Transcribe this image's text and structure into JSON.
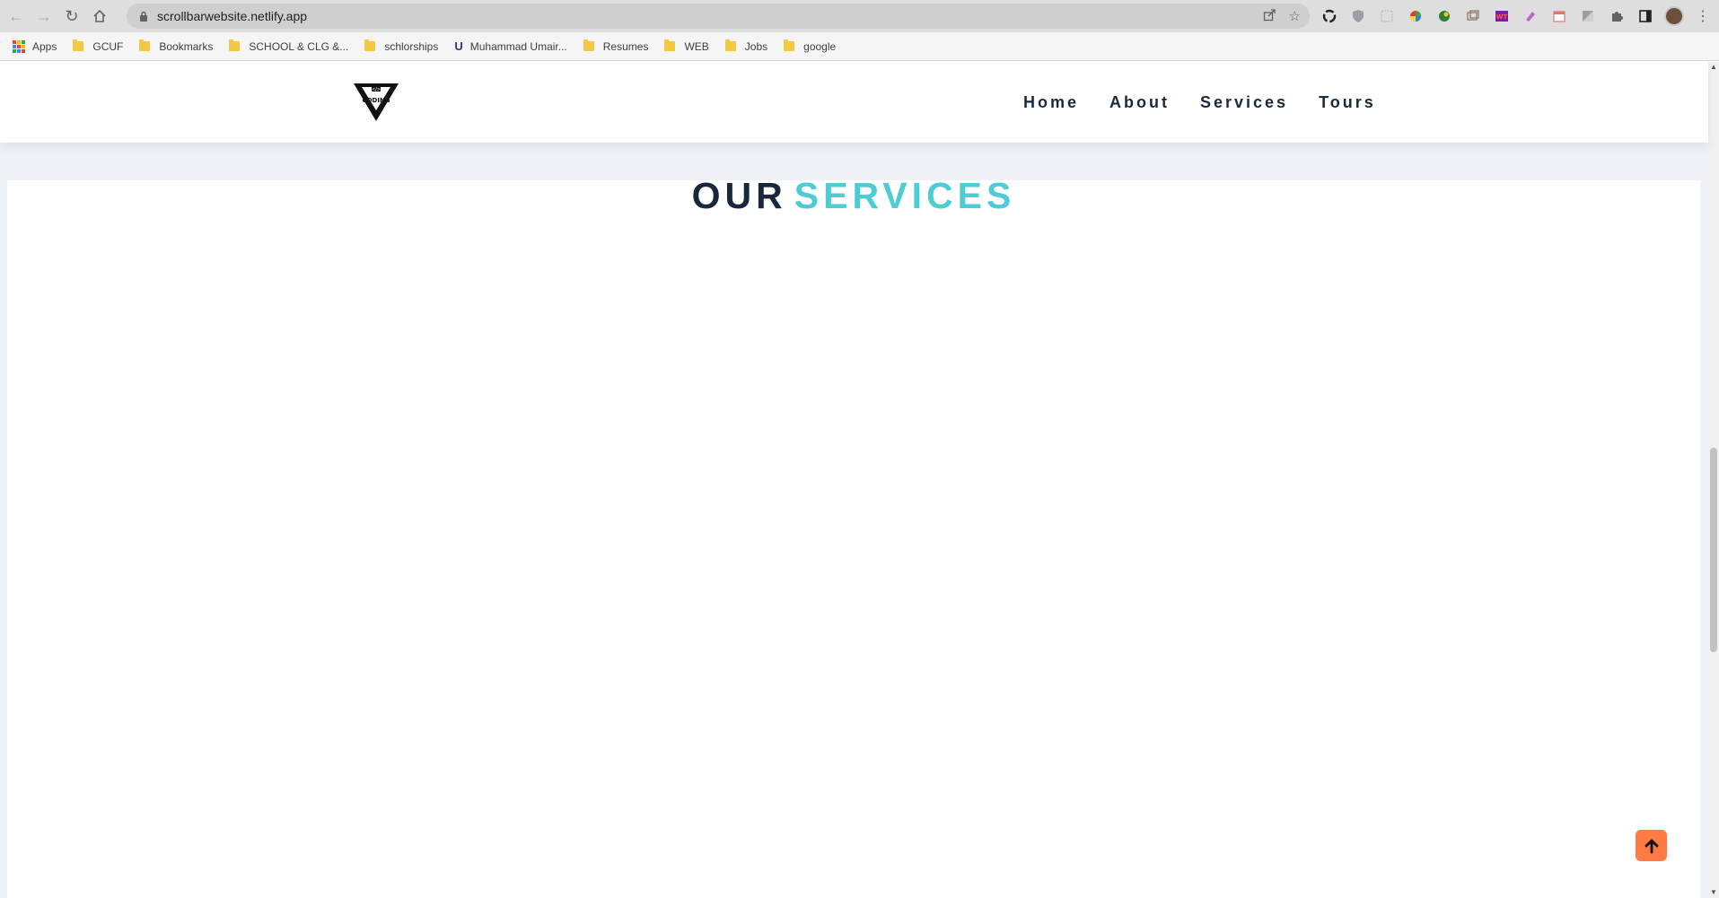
{
  "browser": {
    "url": "scrollbarwebsite.netlify.app",
    "bookmarks": [
      {
        "label": "Apps",
        "type": "apps"
      },
      {
        "label": "GCUF",
        "type": "folder"
      },
      {
        "label": "Bookmarks",
        "type": "folder"
      },
      {
        "label": "SCHOOL & CLG &...",
        "type": "folder"
      },
      {
        "label": "schlorships",
        "type": "folder"
      },
      {
        "label": "Muhammad Umair...",
        "type": "page"
      },
      {
        "label": "Resumes",
        "type": "folder"
      },
      {
        "label": "WEB",
        "type": "folder"
      },
      {
        "label": "Jobs",
        "type": "folder"
      },
      {
        "label": "google",
        "type": "folder"
      }
    ]
  },
  "site": {
    "logo_text": "CODING",
    "nav": [
      "Home",
      "About",
      "Services",
      "Tours"
    ],
    "section_title_part1": "OUR",
    "section_title_part2": "SERVICES"
  },
  "colors": {
    "accent": "#4ecbd3",
    "dark": "#18283a",
    "scroll_button": "#ff7a45"
  }
}
